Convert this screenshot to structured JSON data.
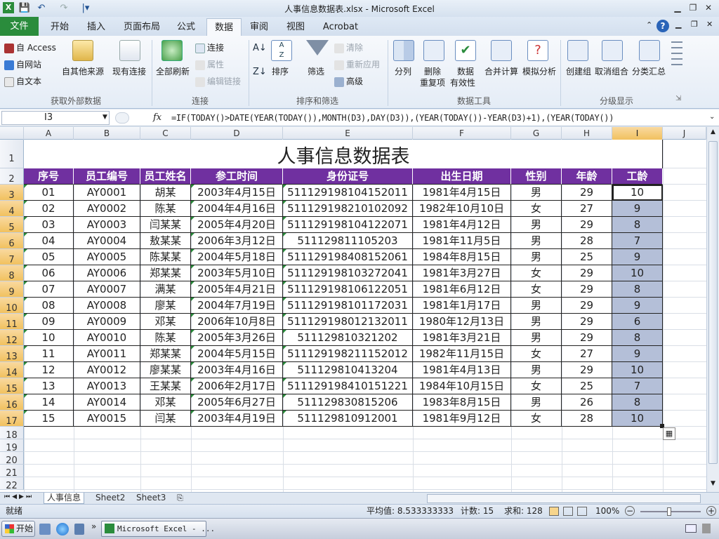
{
  "window": {
    "title": "人事信息数据表.xlsx - Microsoft Excel"
  },
  "quick_access": {
    "save_glyph": "💾",
    "undo_glyph": "↶",
    "redo_glyph": "↷",
    "customize_glyph": "|▾"
  },
  "tabs": [
    {
      "label": "文件"
    },
    {
      "label": "开始"
    },
    {
      "label": "插入"
    },
    {
      "label": "页面布局"
    },
    {
      "label": "公式"
    },
    {
      "label": "数据"
    },
    {
      "label": "审阅"
    },
    {
      "label": "视图"
    },
    {
      "label": "Acrobat"
    }
  ],
  "ribbon": {
    "get_external": {
      "access": "自 Access",
      "web": "自网站",
      "text": "自文本",
      "other": "自其他来源",
      "existing": "现有连接",
      "label": "获取外部数据"
    },
    "connections": {
      "refresh_all": "全部刷新",
      "connections": "连接",
      "properties": "属性",
      "edit_links": "编辑链接",
      "label": "连接"
    },
    "sort_filter": {
      "sort": "排序",
      "filter": "筛选",
      "clear": "清除",
      "reapply": "重新应用",
      "advanced": "高级",
      "label": "排序和筛选"
    },
    "data_tools": {
      "text_to_columns": "分列",
      "remove_dup_1": "删除",
      "remove_dup_2": "重复项",
      "validation_1": "数据",
      "validation_2": "有效性",
      "consolidate": "合并计算",
      "what_if": "模拟分析",
      "label": "数据工具"
    },
    "outline": {
      "group": "创建组",
      "ungroup": "取消组合",
      "subtotal": "分类汇总",
      "label": "分级显示"
    }
  },
  "formula_bar": {
    "name_box": "I3",
    "fx": "fx",
    "formula": "=IF(TODAY()>DATE(YEAR(TODAY()),MONTH(D3),DAY(D3)),(YEAR(TODAY())-YEAR(D3)+1),(YEAR(TODAY())"
  },
  "columns": [
    "A",
    "B",
    "C",
    "D",
    "E",
    "F",
    "G",
    "H",
    "I",
    "J"
  ],
  "rows": [
    "1",
    "2",
    "3",
    "4",
    "5",
    "6",
    "7",
    "8",
    "9",
    "10",
    "11",
    "12",
    "13",
    "14",
    "15",
    "16",
    "17",
    "18",
    "19",
    "20",
    "21",
    "22"
  ],
  "sheet": {
    "title": "人事信息数据表",
    "headers": [
      "序号",
      "员工编号",
      "员工姓名",
      "参工时间",
      "身份证号",
      "出生日期",
      "性别",
      "年龄",
      "工龄"
    ],
    "records": [
      [
        "01",
        "AY0001",
        "胡某",
        "2003年4月15日",
        "511129198104152011",
        "1981年4月15日",
        "男",
        "29",
        "10"
      ],
      [
        "02",
        "AY0002",
        "陈某",
        "2004年4月16日",
        "511129198210102092",
        "1982年10月10日",
        "女",
        "27",
        "9"
      ],
      [
        "03",
        "AY0003",
        "闫某某",
        "2005年4月20日",
        "511129198104122071",
        "1981年4月12日",
        "男",
        "29",
        "8"
      ],
      [
        "04",
        "AY0004",
        "敖某某",
        "2006年3月12日",
        "511129811105203",
        "1981年11月5日",
        "男",
        "28",
        "7"
      ],
      [
        "05",
        "AY0005",
        "陈某某",
        "2004年5月18日",
        "511129198408152061",
        "1984年8月15日",
        "男",
        "25",
        "9"
      ],
      [
        "06",
        "AY0006",
        "郑某某",
        "2003年5月10日",
        "511129198103272041",
        "1981年3月27日",
        "女",
        "29",
        "10"
      ],
      [
        "07",
        "AY0007",
        "满某",
        "2005年4月21日",
        "511129198106122051",
        "1981年6月12日",
        "女",
        "29",
        "8"
      ],
      [
        "08",
        "AY0008",
        "廖某",
        "2004年7月19日",
        "511129198101172031",
        "1981年1月17日",
        "男",
        "29",
        "9"
      ],
      [
        "09",
        "AY0009",
        "邓某",
        "2006年10月8日",
        "511129198012132011",
        "1980年12月13日",
        "男",
        "29",
        "6"
      ],
      [
        "10",
        "AY0010",
        "陈某",
        "2005年3月26日",
        "511129810321202",
        "1981年3月21日",
        "男",
        "29",
        "8"
      ],
      [
        "11",
        "AY0011",
        "郑某某",
        "2004年5月15日",
        "511129198211152012",
        "1982年11月15日",
        "女",
        "27",
        "9"
      ],
      [
        "12",
        "AY0012",
        "廖某某",
        "2003年4月16日",
        "511129810413204",
        "1981年4月13日",
        "男",
        "29",
        "10"
      ],
      [
        "13",
        "AY0013",
        "王某某",
        "2006年2月17日",
        "511129198410151221",
        "1984年10月15日",
        "女",
        "25",
        "7"
      ],
      [
        "14",
        "AY0014",
        "邓某",
        "2005年6月27日",
        "511129830815206",
        "1983年8月15日",
        "男",
        "26",
        "8"
      ],
      [
        "15",
        "AY0015",
        "闫某",
        "2003年4月19日",
        "511129810912001",
        "1981年9月12日",
        "女",
        "28",
        "10"
      ]
    ]
  },
  "sheet_tabs": [
    {
      "label": "人事信息"
    },
    {
      "label": "Sheet2"
    },
    {
      "label": "Sheet3"
    }
  ],
  "status": {
    "ready": "就绪",
    "average": "平均值: 8.533333333",
    "count": "计数: 15",
    "sum": "求和: 128",
    "zoom": "100%"
  },
  "taskbar": {
    "start": "开始",
    "app": "Microsoft Excel - ..."
  },
  "colors": {
    "header_bg": "#7030a0",
    "selection": "#b4bfd8",
    "file_tab": "#2a8c3c"
  }
}
